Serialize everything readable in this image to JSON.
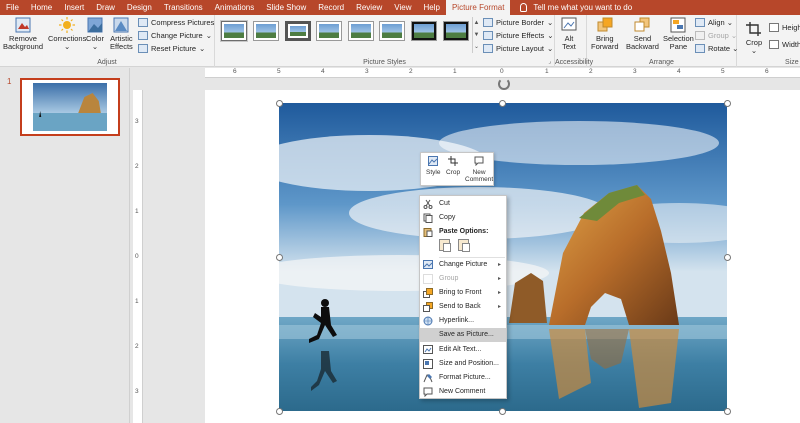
{
  "tabs": [
    "File",
    "Home",
    "Insert",
    "Draw",
    "Design",
    "Transitions",
    "Animations",
    "Slide Show",
    "Record",
    "Review",
    "View",
    "Help",
    "Picture Format"
  ],
  "active_tab": "Picture Format",
  "tell_me": "Tell me what you want to do",
  "ribbon": {
    "remove_background": [
      "Remove",
      "Background"
    ],
    "corrections": "Corrections",
    "color": "Color",
    "artistic": [
      "Artistic",
      "Effects"
    ],
    "compress": "Compress Pictures",
    "change_picture": "Change Picture",
    "reset_picture": "Reset Picture",
    "adjust_label": "Adjust",
    "picture_styles_label": "Picture Styles",
    "picture_border": "Picture Border",
    "picture_effects": "Picture Effects",
    "picture_layout": "Picture Layout",
    "alt_text": [
      "Alt",
      "Text"
    ],
    "accessibility_label": "Accessibility",
    "bring_forward": [
      "Bring",
      "Forward"
    ],
    "send_backward": [
      "Send",
      "Backward"
    ],
    "selection_pane": [
      "Selection",
      "Pane"
    ],
    "align": "Align",
    "group": "Group",
    "rotate": "Rotate",
    "arrange_label": "Arrange",
    "crop": "Crop",
    "height": "Heigh",
    "width": "Width",
    "size_label": "Size"
  },
  "thumbnail": {
    "number": "1"
  },
  "hruler_numbers": [
    "6",
    "5",
    "4",
    "3",
    "2",
    "1",
    "0",
    "1",
    "2",
    "3",
    "4",
    "5",
    "6"
  ],
  "vruler_numbers": [
    "3",
    "2",
    "1",
    "0",
    "1",
    "2",
    "3"
  ],
  "mini_toolbar": {
    "style": "Style",
    "crop": "Crop",
    "new_comment": [
      "New",
      "Comment"
    ]
  },
  "context_menu": {
    "cut": "Cut",
    "copy": "Copy",
    "paste_options": "Paste Options:",
    "change_picture": "Change Picture",
    "group": "Group",
    "bring_to_front": "Bring to Front",
    "send_to_back": "Send to Back",
    "hyperlink": "Hyperlink...",
    "save_as_picture": "Save as Picture...",
    "edit_alt_text": "Edit Alt Text...",
    "size_and_position": "Size and Position...",
    "format_picture": "Format Picture...",
    "new_comment": "New Comment"
  },
  "colors": {
    "accent": "#b7472a",
    "ribbon_bg": "#f3f3f3",
    "menu_highlight": "#d0d0d0"
  }
}
